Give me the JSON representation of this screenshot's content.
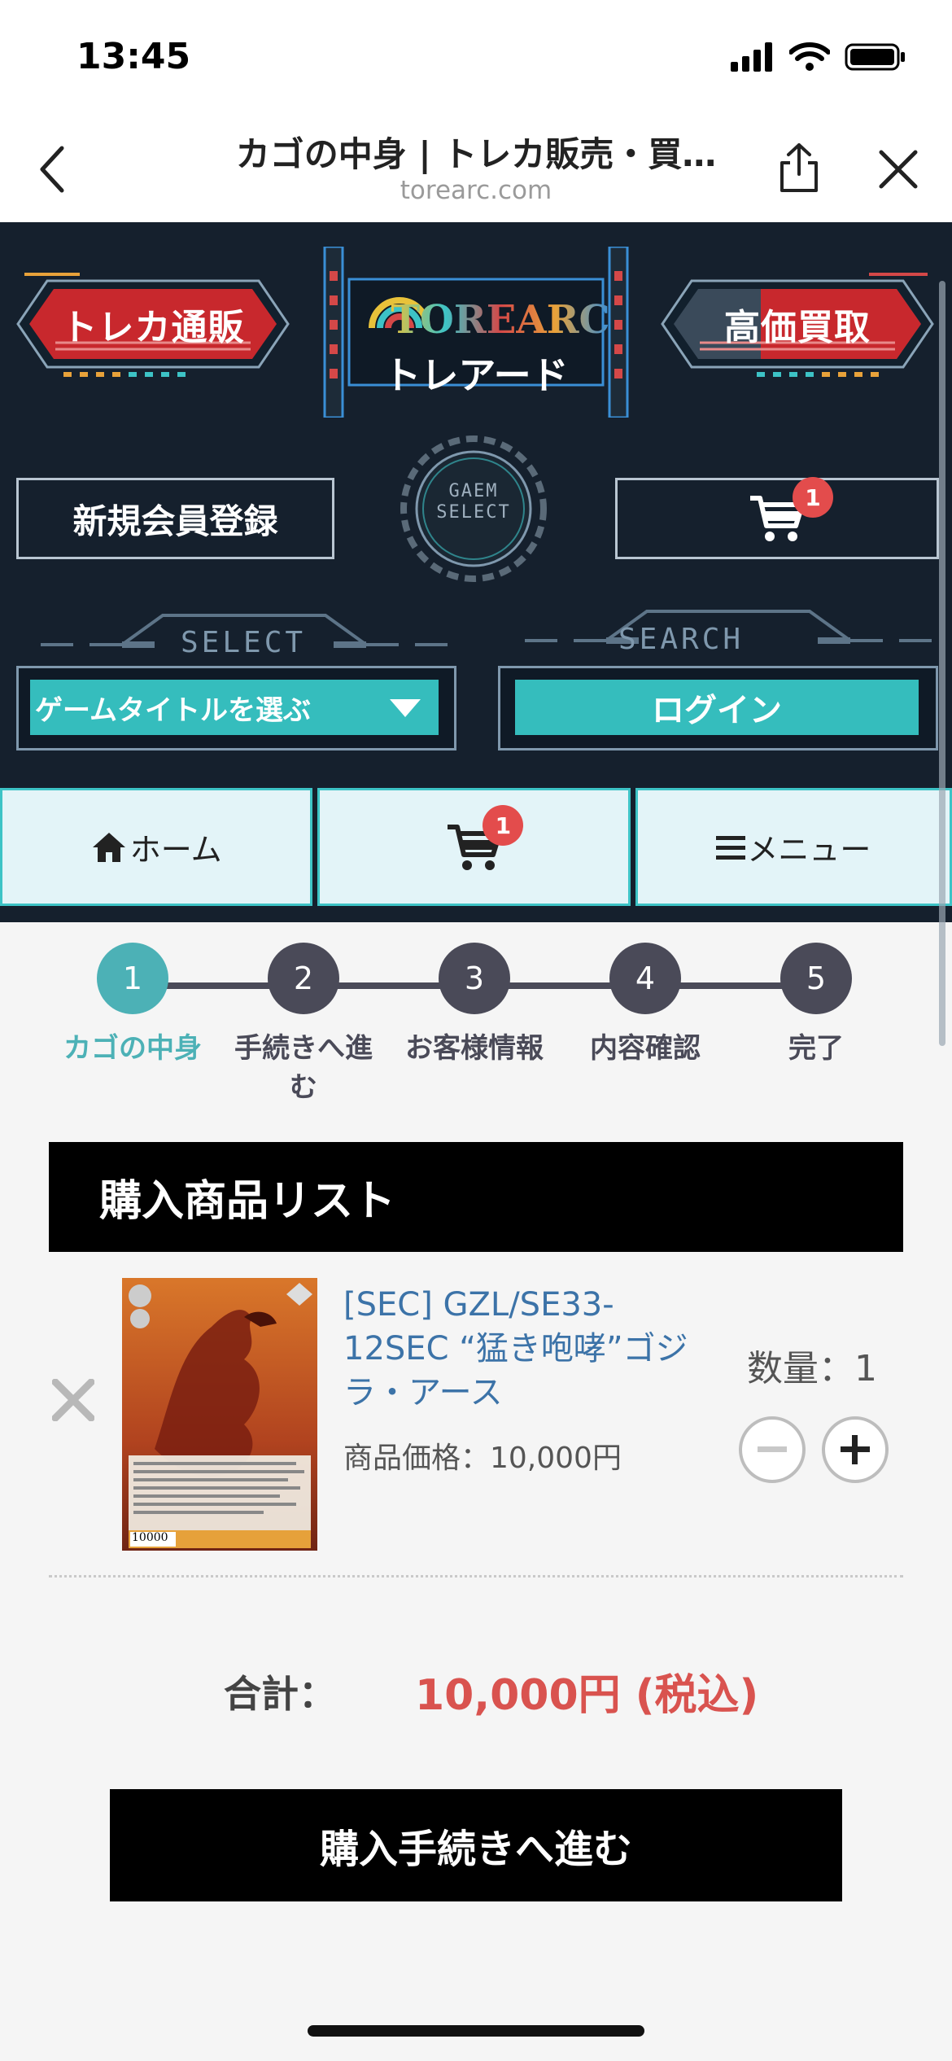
{
  "status_bar": {
    "time": "13:45"
  },
  "browser": {
    "title": "カゴの中身 | トレカ販売・買…",
    "url": "torearc.com"
  },
  "header": {
    "shop_label": "トレカ通販",
    "buy_label": "高価買取",
    "logo_text": "TOREARC",
    "logo_subtext": "トレアード",
    "register_label": "新規会員登録",
    "gaem_text_1": "GAEM",
    "gaem_text_2": "SELECT",
    "cart_badge": "1",
    "select_deco": "SELECT",
    "search_deco": "SEARCH",
    "game_select_label": "ゲームタイトルを選ぶ",
    "login_label": "ログイン"
  },
  "nav": {
    "home_label": "ホーム",
    "cart_badge": "1",
    "menu_label": "メニュー"
  },
  "steps": [
    {
      "num": "1",
      "label": "カゴの中身"
    },
    {
      "num": "2",
      "label": "手続きへ進む"
    },
    {
      "num": "3",
      "label": "お客様情報"
    },
    {
      "num": "4",
      "label": "内容確認"
    },
    {
      "num": "5",
      "label": "完了"
    }
  ],
  "list": {
    "title": "購入商品リスト",
    "item": {
      "name": "[SEC] GZL/SE33-12SEC “猛き咆哮”ゴジラ・アース",
      "price": "商品価格：10,000円",
      "quantity": "数量：1",
      "card_cost": "10000"
    }
  },
  "total": {
    "label": "合計：",
    "value": "10,000円 (税込)"
  },
  "checkout_label": "購入手続きへ進む",
  "colors": {
    "teal": "#35bdbd",
    "dark_bg": "#15202d",
    "red": "#d9534f",
    "step_active": "#4cb1b6",
    "step_inactive": "#4a4a58"
  }
}
